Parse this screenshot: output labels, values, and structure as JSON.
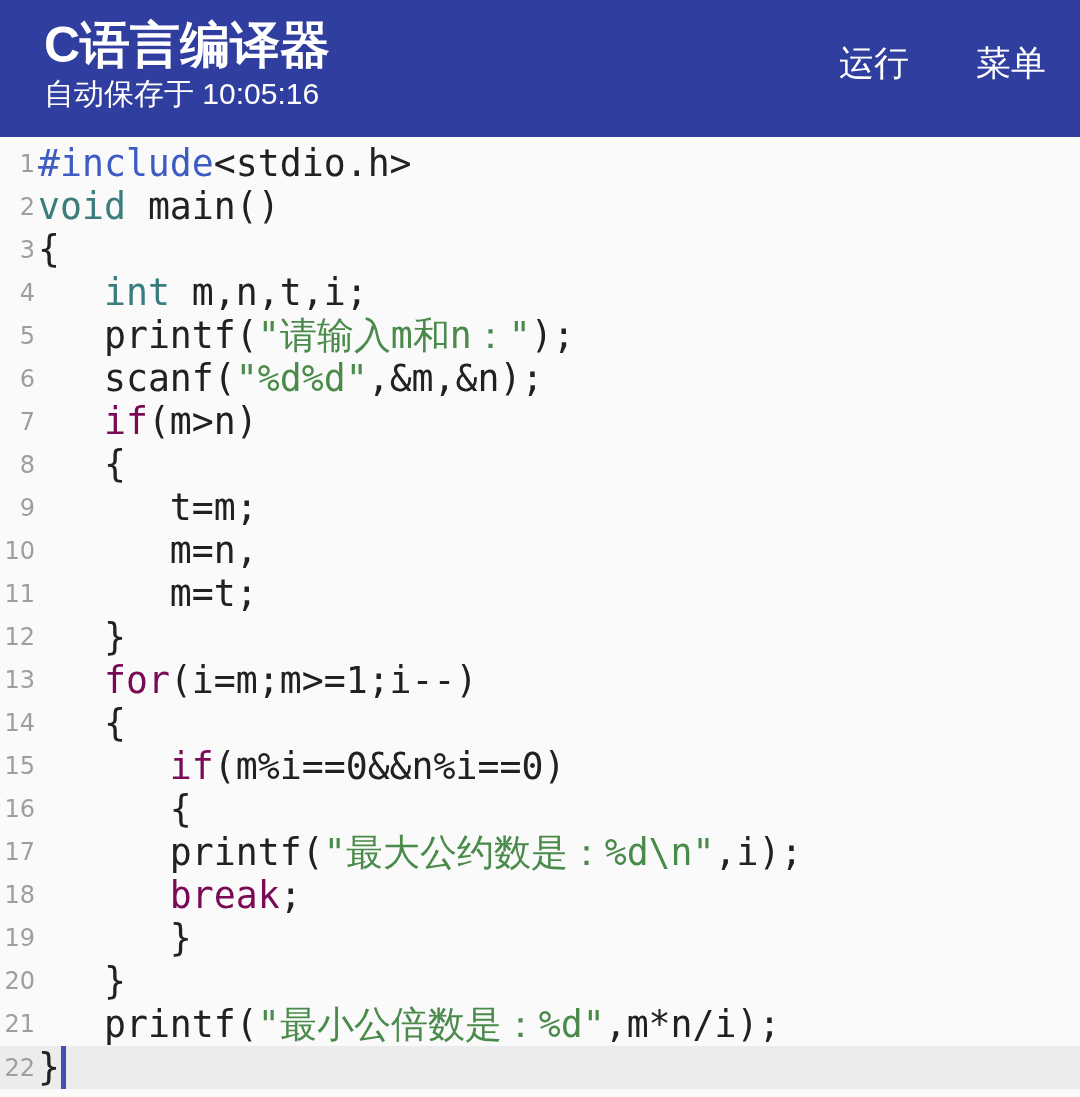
{
  "app_bar": {
    "title": "C语言编译器",
    "subtitle": "自动保存于 10:05:16",
    "actions": [
      "运行",
      "菜单"
    ]
  },
  "editor": {
    "lines": [
      {
        "number": "1",
        "current": false,
        "tokens": [
          {
            "kind": "preprocessor",
            "text": "#include"
          },
          {
            "kind": "plain",
            "text": "<stdio.h>"
          }
        ]
      },
      {
        "number": "2",
        "current": false,
        "tokens": [
          {
            "kind": "type",
            "text": "void"
          },
          {
            "kind": "plain",
            "text": " main()"
          }
        ]
      },
      {
        "number": "3",
        "current": false,
        "tokens": [
          {
            "kind": "plain",
            "text": "{"
          }
        ]
      },
      {
        "number": "4",
        "current": false,
        "tokens": [
          {
            "kind": "type",
            "text": "   int"
          },
          {
            "kind": "plain",
            "text": " m,n,t,i;"
          }
        ]
      },
      {
        "number": "5",
        "current": false,
        "tokens": [
          {
            "kind": "plain",
            "text": "   printf("
          },
          {
            "kind": "string",
            "text": "\"请输入m和n：\""
          },
          {
            "kind": "plain",
            "text": ");"
          }
        ]
      },
      {
        "number": "6",
        "current": false,
        "tokens": [
          {
            "kind": "plain",
            "text": "   scanf("
          },
          {
            "kind": "string",
            "text": "\"%d%d\""
          },
          {
            "kind": "plain",
            "text": ",&m,&n);"
          }
        ]
      },
      {
        "number": "7",
        "current": false,
        "tokens": [
          {
            "kind": "keyword",
            "text": "   if"
          },
          {
            "kind": "plain",
            "text": "(m>n)"
          }
        ]
      },
      {
        "number": "8",
        "current": false,
        "tokens": [
          {
            "kind": "plain",
            "text": "   {"
          }
        ]
      },
      {
        "number": "9",
        "current": false,
        "tokens": [
          {
            "kind": "plain",
            "text": "      t=m;"
          }
        ]
      },
      {
        "number": "10",
        "current": false,
        "tokens": [
          {
            "kind": "plain",
            "text": "      m=n,"
          }
        ]
      },
      {
        "number": "11",
        "current": false,
        "tokens": [
          {
            "kind": "plain",
            "text": "      m=t;"
          }
        ]
      },
      {
        "number": "12",
        "current": false,
        "tokens": [
          {
            "kind": "plain",
            "text": "   }"
          }
        ]
      },
      {
        "number": "13",
        "current": false,
        "tokens": [
          {
            "kind": "keyword",
            "text": "   for"
          },
          {
            "kind": "plain",
            "text": "(i=m;m>=1;i--)"
          }
        ]
      },
      {
        "number": "14",
        "current": false,
        "tokens": [
          {
            "kind": "plain",
            "text": "   {"
          }
        ]
      },
      {
        "number": "15",
        "current": false,
        "tokens": [
          {
            "kind": "keyword",
            "text": "      if"
          },
          {
            "kind": "plain",
            "text": "(m%i==0&&n%i==0)"
          }
        ]
      },
      {
        "number": "16",
        "current": false,
        "tokens": [
          {
            "kind": "plain",
            "text": "      {"
          }
        ]
      },
      {
        "number": "17",
        "current": false,
        "tokens": [
          {
            "kind": "plain",
            "text": "      printf("
          },
          {
            "kind": "string",
            "text": "\"最大公约数是：%d\\n\""
          },
          {
            "kind": "plain",
            "text": ",i);"
          }
        ]
      },
      {
        "number": "18",
        "current": false,
        "tokens": [
          {
            "kind": "keyword",
            "text": "      break"
          },
          {
            "kind": "plain",
            "text": ";"
          }
        ]
      },
      {
        "number": "19",
        "current": false,
        "tokens": [
          {
            "kind": "plain",
            "text": "      }"
          }
        ]
      },
      {
        "number": "20",
        "current": false,
        "tokens": [
          {
            "kind": "plain",
            "text": "   }"
          }
        ]
      },
      {
        "number": "21",
        "current": false,
        "tokens": [
          {
            "kind": "plain",
            "text": "   printf("
          },
          {
            "kind": "string",
            "text": "\"最小公倍数是：%d\""
          },
          {
            "kind": "plain",
            "text": ",m*n/i);"
          }
        ]
      },
      {
        "number": "22",
        "current": true,
        "tokens": [
          {
            "kind": "plain",
            "text": "}"
          }
        ]
      }
    ]
  }
}
